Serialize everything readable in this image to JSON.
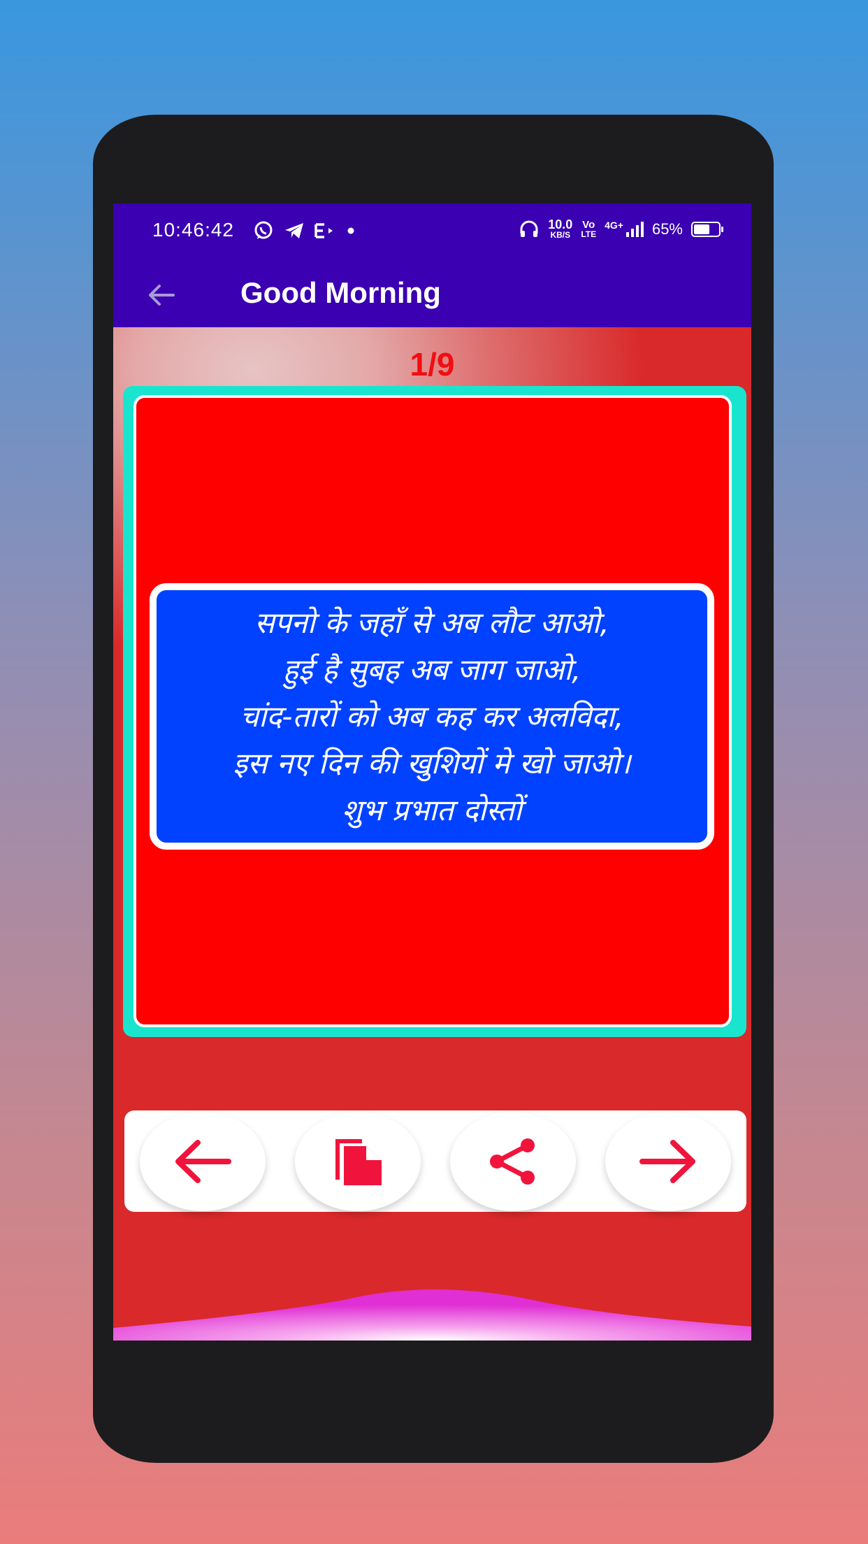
{
  "status_bar": {
    "time": "10:46:42",
    "net_speed_value": "10.0",
    "net_speed_unit": "KB/S",
    "volte_top": "Vo",
    "volte_bottom": "LTE",
    "network": "4G+",
    "battery_percent": "65%",
    "battery_level": 0.65
  },
  "app_bar": {
    "title": "Good Morning",
    "back_icon": "arrow-left-icon"
  },
  "counter": "1/9",
  "quote": {
    "lines": [
      "सपनो के जहाँ से अब लौट आओ,",
      "हुई है सुबह अब जाग जाओ,",
      "चांद-तारों को अब कह कर अलविदा,",
      "इस नए दिन की खुशियों मे खो जाओ।",
      "शुभ प्रभात दोस्तों"
    ]
  },
  "toolbar": {
    "buttons": [
      {
        "icon": "arrow-left-icon"
      },
      {
        "icon": "copy-icon"
      },
      {
        "icon": "share-icon"
      },
      {
        "icon": "arrow-right-icon"
      }
    ]
  },
  "colors": {
    "app_bar": "#3a00b1",
    "card_frame": "#19e5cf",
    "card_background": "#ff0000",
    "quote_background": "#0042ff",
    "accent_red": "#f0143c"
  }
}
